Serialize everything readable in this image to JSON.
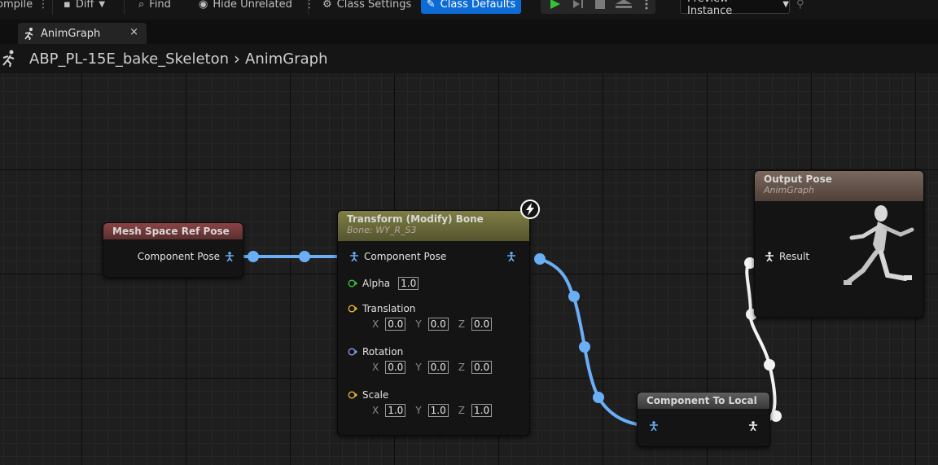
{
  "toolbar": {
    "compile_label": "ompile",
    "diff_label": "Diff",
    "find_label": "Find",
    "hide_unrelated_label": "Hide Unrelated",
    "class_settings_label": "Class Settings",
    "class_defaults_label": "Class Defaults",
    "preview_label": "Preview Instance"
  },
  "tab": {
    "label": "AnimGraph",
    "close": "×"
  },
  "breadcrumb": {
    "blueprint": "ABP_PL-15E_bake_Skeleton",
    "separator": "›",
    "graph": "AnimGraph"
  },
  "nodes": {
    "mesh_space": {
      "title": "Mesh Space Ref Pose",
      "out_pin": "Component Pose"
    },
    "transform": {
      "title": "Transform (Modify) Bone",
      "subtitle": "Bone: WY_R_S3",
      "in_pin": "Component Pose",
      "alpha_label": "Alpha",
      "alpha_value": "1.0",
      "translation_label": "Translation",
      "translation": {
        "x": "0.0",
        "y": "0.0",
        "z": "0.0"
      },
      "rotation_label": "Rotation",
      "rotation": {
        "x": "0.0",
        "y": "0.0",
        "z": "0.0"
      },
      "scale_label": "Scale",
      "scale": {
        "x": "1.0",
        "y": "1.0",
        "z": "1.0"
      },
      "axis_x": "X",
      "axis_y": "Y",
      "axis_z": "Z"
    },
    "component_to_local": {
      "title": "Component To Local"
    },
    "output_pose": {
      "title": "Output Pose",
      "subtitle": "AnimGraph",
      "result_pin": "Result"
    }
  },
  "colors": {
    "accent_blue": "#0d6bd6",
    "pose_wire": "#6aaef5",
    "local_wire": "#f2f2f2",
    "mesh_header": "#7a3c3c",
    "transform_header": "#7b7a42",
    "output_header": "#6c5a50",
    "ctl_header": "#5a5a5a"
  }
}
